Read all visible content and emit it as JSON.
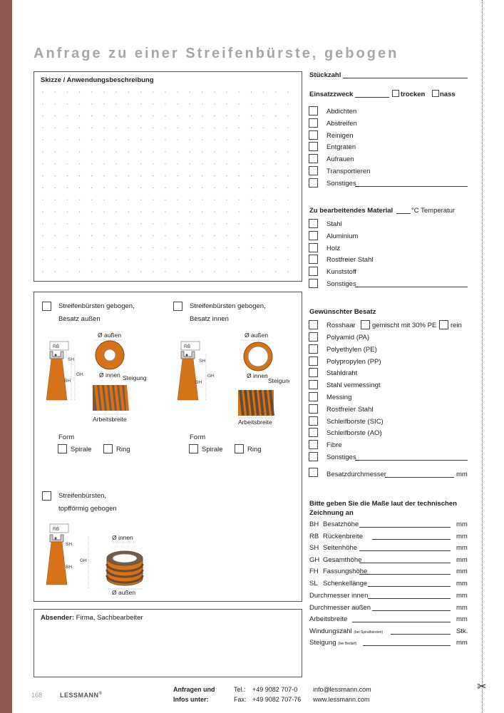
{
  "title": "Anfrage zu einer Streifenbürste, gebogen",
  "sketch": {
    "label": "Skizze / Anwendungsbeschreibung"
  },
  "options": {
    "a": {
      "line1": "Streifenbürsten gebogen,",
      "line2": "Besatz außen"
    },
    "b": {
      "line1": "Streifenbürsten gebogen,",
      "line2": "Besatz innen"
    },
    "c": {
      "line1": "Streifenbürsten,",
      "line2": "topfförmig gebogen"
    },
    "diagram": {
      "rb": "RB",
      "sh": "SH",
      "gh": "GH",
      "bh": "BH",
      "d_outer": "Ø außen",
      "d_inner": "Ø innen",
      "pitch": "Steigung",
      "width": "Arbeitsbreite"
    },
    "form_label": "Form",
    "form_spiral": "Spirale",
    "form_ring": "Ring"
  },
  "sender": {
    "label": "Absender:",
    "value": "Firma, Sachbearbeiter"
  },
  "quantity": {
    "label": "Stückzahl"
  },
  "purpose": {
    "label": "Einsatzzweck",
    "dry": "trocken",
    "wet": "nass",
    "items": [
      "Abdichten",
      "Abstreifen",
      "Reinigen",
      "Entgraten",
      "Aufrauen",
      "Transportieren",
      "Sonstiges"
    ]
  },
  "material": {
    "label": "Zu bearbeitendes Material",
    "temp": "°C Temperatur",
    "items": [
      "Stahl",
      "Aluminium",
      "Holz",
      "Rostfreier Stahl",
      "Kunststoff",
      "Sonstiges"
    ]
  },
  "fill": {
    "label": "Gewünschter Besatz",
    "horsehair": "Rosshaar",
    "mixed": "gemischt mit 30% PE",
    "pure": "rein",
    "items": [
      "Polyamid (PA)",
      "Polyethylen (PE)",
      "Polypropylen (PP)",
      "Stahldraht",
      "Stahl vermessingt",
      "Messing",
      "Rostfreier Stahl",
      "Schleifborste (SIC)",
      "Schleifborste (AO)",
      "Fibre",
      "Sonstiges"
    ],
    "diameter": "Besatzdurchmesser",
    "unit": "mm"
  },
  "dims": {
    "heading": "Bitte geben Sie die Maße laut der technischen Zeichnung an",
    "rows": [
      {
        "abbr": "BH",
        "label": "Besatzhöhe",
        "unit": "mm"
      },
      {
        "abbr": "RB",
        "label": "Rückenbreite",
        "unit": "mm"
      },
      {
        "abbr": "SH",
        "label": "Seitenhöhe",
        "unit": "mm"
      },
      {
        "abbr": "GH",
        "label": "Gesamthöhe",
        "unit": "mm"
      },
      {
        "abbr": "FH",
        "label": "Fassungshöhe",
        "unit": "mm"
      },
      {
        "abbr": "SL",
        "label": "Schenkellänge",
        "unit": "mm"
      }
    ],
    "inner": "Durchmesser innen",
    "outer": "Durchmesser außen",
    "width": "Arbeitsbreite",
    "turns": "Windungszahl",
    "turns_note": "(bei Spiralbürsten)",
    "turns_unit": "Stk.",
    "pitch": "Steigung",
    "pitch_note": "(bei Bedarf)",
    "unit": "mm"
  },
  "footer": {
    "page": "168",
    "brand": "LESSMANN",
    "reg": "®",
    "info1": "Anfragen und",
    "info2": "Infos unter:",
    "tel_label": "Tel.:",
    "tel": "+49 9082 707-0",
    "fax_label": "Fax:",
    "fax": "+49 9082 707-76",
    "email": "info@lessmann.com",
    "web": "www.lessmann.com"
  },
  "colors": {
    "brush": "#d4731a",
    "strip": "#8b5a52",
    "title": "#a6a6a6"
  }
}
